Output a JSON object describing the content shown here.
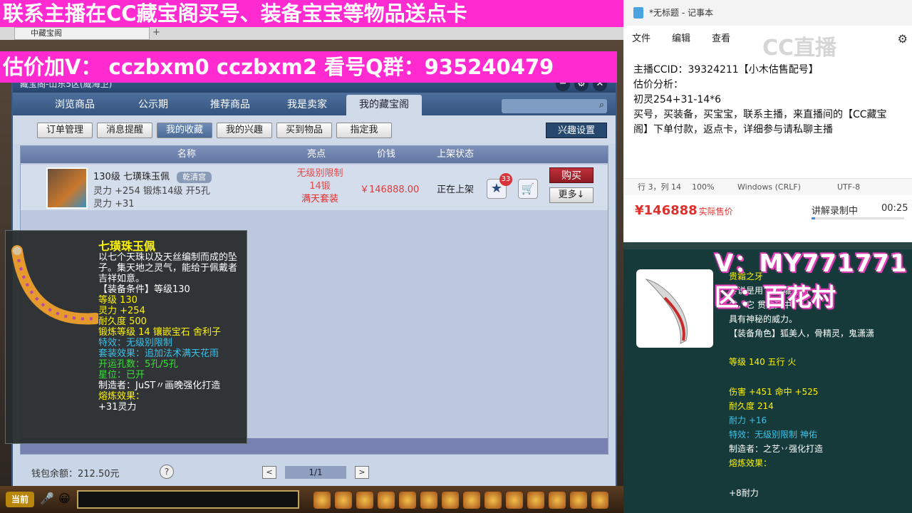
{
  "banners": {
    "top": "联系主播在CC藏宝阁买号、装备宝宝等物品送点卡",
    "price": "估价加V：  cczbxm0   cczbxm2   看号Q群：935240479"
  },
  "browser_tab": {
    "label": "中藏宝阁"
  },
  "shop": {
    "title": "藏宝阁-山东5区(威海卫)",
    "nav_tabs": [
      "浏览商品",
      "公示期",
      "推荐商品",
      "我是卖家",
      "我的藏宝阁"
    ],
    "sub_buttons": [
      "订单管理",
      "消息提醒",
      "我的收藏",
      "我的兴趣",
      "买到物品",
      "指定我"
    ],
    "interest_settings": "兴趣设置",
    "columns": [
      "名称",
      "亮点",
      "价钱",
      "上架状态"
    ],
    "item": {
      "line1": "130级  七璜珠玉佩",
      "badge": "乾清宫",
      "line2": "灵力 +254 锻炼14级 开5孔",
      "line3": "灵力 +31",
      "feature1": "无级别限制",
      "feature2": "14锻",
      "feature3": "满天套装",
      "price": "￥146888.00",
      "status": "正在上架",
      "fav_count": "33",
      "buy": "购买",
      "more": "更多↓"
    },
    "wallet": "钱包余额：212.50元",
    "help": "?",
    "page": "1/1",
    "prev": "<",
    "next": ">"
  },
  "tooltip": {
    "name": "七璜珠玉佩",
    "desc": "以七个天珠以及天丝编制而成的坠子。集天地之灵气，能给于佩戴者吉祥如意。",
    "req": "【装备条件】等级130",
    "lines_yellow": [
      "等级 130",
      "灵力 +254",
      "耐久度 500",
      "锻炼等级 14   镶嵌宝石 舍利子"
    ],
    "effect": "特效：无级别限制",
    "set": "套装效果：追加法术满天花雨",
    "holes": "开运孔数：5孔/5孔",
    "star": "星位：已开",
    "maker": "制造者：JuST〃画晚强化打造",
    "melt_label": "熔炼效果：",
    "melt_value": "+31灵力"
  },
  "game_bar": {
    "current": "当前"
  },
  "notepad": {
    "title": "*无标题 - 记事本",
    "menu": [
      "文件",
      "编辑",
      "查看"
    ],
    "logo": "CC直播",
    "text": "主播CCID：39324211【小木估售配号】\n估价分析：\n初灵254+31-14*6\n买号，买装备，买宝宝，联系主播，来直播间的【CC藏宝\n阁】下单付款，返点卡，详细参与请私聊主播",
    "status": {
      "pos": "行 3，列 14",
      "zoom": "100%",
      "eol": "Windows (CRLF)",
      "enc": "UTF-8"
    },
    "price": "¥146888",
    "price_label": "实际售价",
    "recording": "讲解录制中",
    "time": "00:25",
    "progress": 0.04
  },
  "item_panel": {
    "overlay_v": "V：MY771771",
    "overlay_qu": "区：百花村",
    "name": "贵霜之牙",
    "desc1": "传说是用              牙所雕刻而",
    "desc2": "成，它                   贯注其中，",
    "desc3": "具有神秘的威力。",
    "role": "【装备角色】狐美人，骨精灵，鬼潇潇",
    "level": "等级 140 五行 火",
    "damage": "伤害 +451 命中 +525",
    "durability": "耐久度 214",
    "stamina": "耐力 +16",
    "effect": "特效：无级别限制 神佑",
    "maker": "制造者：之艺丷强化打造",
    "melt_label": "熔炼效果：",
    "melt_value": "+8耐力"
  }
}
